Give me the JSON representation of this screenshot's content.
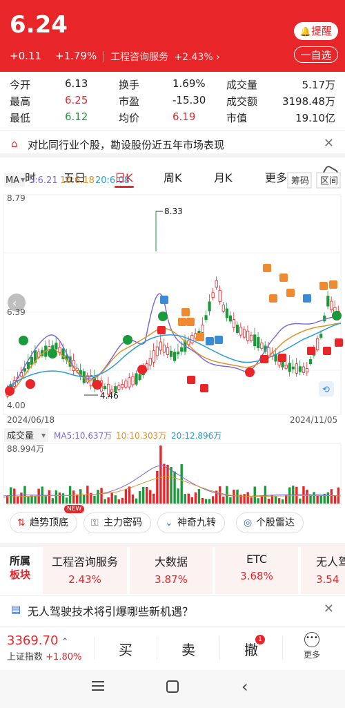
{
  "header": {
    "price": "6.24",
    "change": "+0.11",
    "change_pct": "+1.79%",
    "industry_name": "工程咨询服务",
    "industry_pct": "+2.43%",
    "alert_label": "提醒",
    "watchlist_label": "一自选"
  },
  "stats": [
    {
      "l1": "今开",
      "v1": "6.13",
      "l2": "换手",
      "v2": "1.69%",
      "l3": "成交量",
      "v3": "5.17万"
    },
    {
      "l1": "最高",
      "v1": "6.25",
      "l2": "市盈",
      "v2": "-15.30",
      "l3": "成交额",
      "v3": "3198.48万"
    },
    {
      "l1": "最低",
      "v1": "6.12",
      "l2": "均价",
      "v2": "6.19",
      "l3": "市值",
      "v3": "19.10亿"
    }
  ],
  "notice": {
    "text": "对比同行业个股，勘设股份近五年市场表现"
  },
  "tabs": [
    "分时",
    "五日",
    "日K",
    "周K",
    "月K",
    "更多"
  ],
  "chart": {
    "ma_label": "MA",
    "ma5": "5:6.21",
    "ma10": "10:6.18",
    "ma20": "20:6.08",
    "chip_label": "筹码",
    "range_label": "区间",
    "y_top": "8.79",
    "y_mid": "6.39",
    "y_bottom": "4.00",
    "peak_label": "8.33",
    "low_label": "4.46",
    "date_start": "2024/06/18",
    "date_end": "2024/11/05",
    "vol_label": "成交量",
    "vol_ma5": "MA5:10.637万",
    "vol_ma10": "10:10.303万",
    "vol_ma20": "20:12.896万",
    "vol_top": "88.994万",
    "colors": {
      "up": "#e8262a",
      "down": "#1a9a3a",
      "ma5": "#7b6bd6",
      "ma10": "#e0902a",
      "ma20": "#2a9ad6"
    }
  },
  "tools": {
    "trend": "趋势顶底",
    "trend_badge": "NEW",
    "main": "主力密码",
    "nine": "神奇九转",
    "radar": "个股雷达"
  },
  "sectors": {
    "title1": "所属",
    "title2": "板块",
    "items": [
      {
        "name": "工程咨询服务",
        "pct": "2.43%"
      },
      {
        "name": "大数据",
        "pct": "3.87%"
      },
      {
        "name": "ETC",
        "pct": "3.68%"
      },
      {
        "name": "无人驾",
        "pct": "3.54"
      }
    ]
  },
  "news": {
    "text": "无人驾驶技术将引爆哪些新机遇？"
  },
  "bottom": {
    "index_value": "3369.70",
    "index_name": "上证指数",
    "index_pct": "+1.80%",
    "buy": "买",
    "sell": "卖",
    "cancel": "撤",
    "cancel_badge": "1",
    "more": "更多"
  }
}
